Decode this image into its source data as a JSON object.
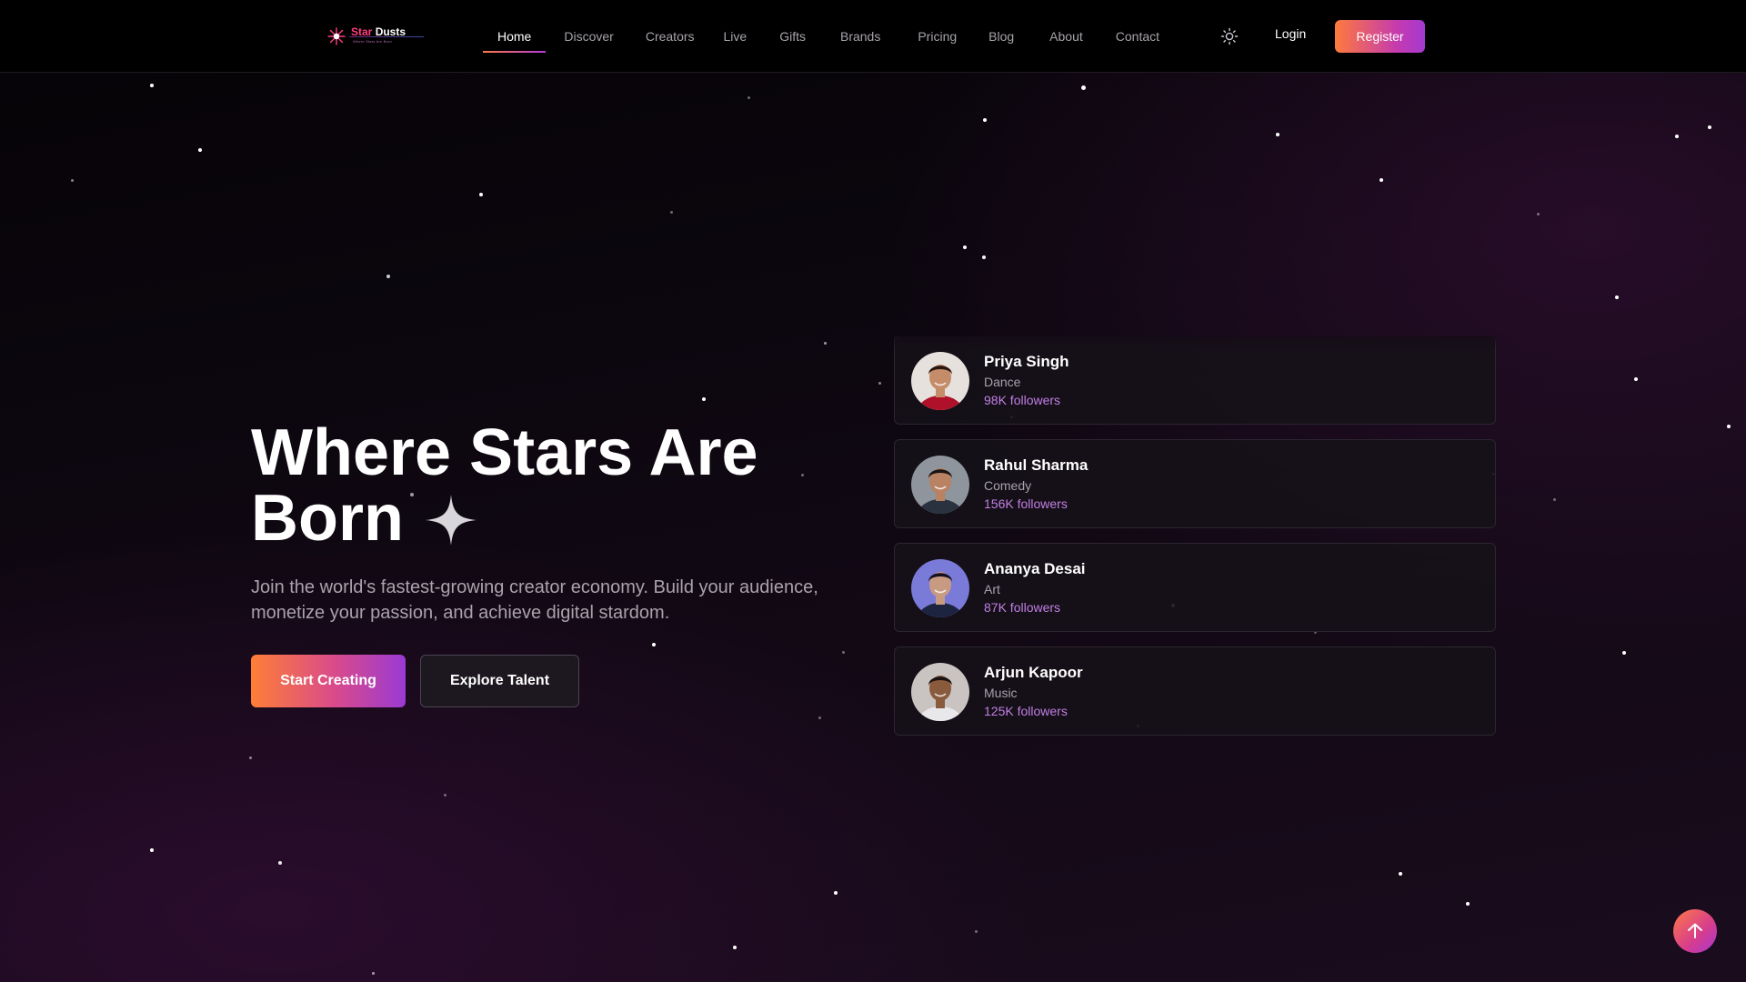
{
  "brand": {
    "name_part1": "Star",
    "name_part2": "Dusts",
    "tagline": "Where Stars Are Born",
    "accent": "#ff3d7f"
  },
  "nav": {
    "items": [
      {
        "label": "Home",
        "active": true
      },
      {
        "label": "Discover",
        "active": false
      },
      {
        "label": "Creators",
        "active": false
      },
      {
        "label": "Live",
        "active": false
      },
      {
        "label": "Gifts",
        "active": false
      },
      {
        "label": "Brands",
        "active": false
      },
      {
        "label": "Pricing",
        "active": false
      },
      {
        "label": "Blog",
        "active": false
      },
      {
        "label": "About",
        "active": false
      },
      {
        "label": "Contact",
        "active": false
      }
    ],
    "theme_icon": "sun-icon",
    "login_label": "Login",
    "register_label": "Register"
  },
  "hero": {
    "title_line1": "Where Stars Are",
    "title_line2": "Born",
    "title_icon": "sparkle-icon",
    "subtitle": "Join the world's fastest-growing creator economy. Build your audience, monetize your passion, and achieve digital stardom.",
    "primary_button": "Start Creating",
    "secondary_button": "Explore Talent"
  },
  "creators": [
    {
      "name": "Arjun Kapoor",
      "category": "Music",
      "followers": "125K followers",
      "skin": "#8a5a3c",
      "hair": "#1a1210",
      "shirt": "#e8e8ea",
      "bg": "#c9c4c2"
    },
    {
      "name": "Priya Singh",
      "category": "Dance",
      "followers": "98K followers",
      "skin": "#c58c6a",
      "hair": "#2a1410",
      "shirt": "#b0112a",
      "bg": "#e6e1dc"
    },
    {
      "name": "Rahul Sharma",
      "category": "Comedy",
      "followers": "156K followers",
      "skin": "#b98262",
      "hair": "#1a1412",
      "shirt": "#2a3240",
      "bg": "#8e959c"
    },
    {
      "name": "Ananya Desai",
      "category": "Art",
      "followers": "87K followers",
      "skin": "#c99a82",
      "hair": "#161020",
      "shirt": "#1d2440",
      "bg": "#7a7ad8"
    },
    {
      "name": "Arjun Kapoor",
      "category": "Music",
      "followers": "125K followers",
      "skin": "#8a5a3c",
      "hair": "#1a1210",
      "shirt": "#e8e8ea",
      "bg": "#c9c4c2"
    }
  ],
  "scroll_top_icon": "arrow-up-icon"
}
